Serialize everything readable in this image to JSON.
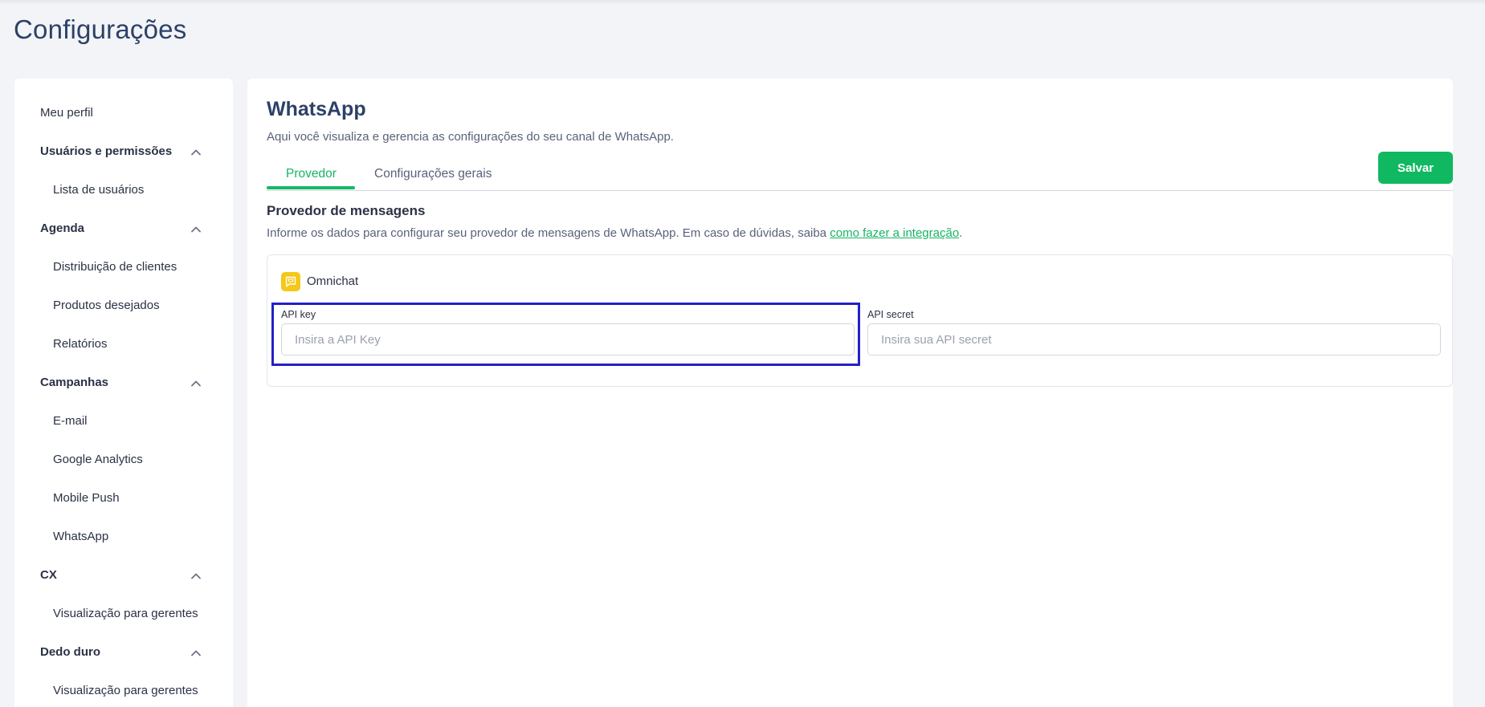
{
  "page": {
    "title": "Configurações"
  },
  "sidebar": {
    "items": [
      {
        "label": "Meu perfil",
        "type": "item"
      },
      {
        "label": "Usuários e permissões",
        "type": "section"
      },
      {
        "label": "Lista de usuários",
        "type": "sub"
      },
      {
        "label": "Agenda",
        "type": "section"
      },
      {
        "label": "Distribuição de clientes",
        "type": "sub"
      },
      {
        "label": "Produtos desejados",
        "type": "sub"
      },
      {
        "label": "Relatórios",
        "type": "sub"
      },
      {
        "label": "Campanhas",
        "type": "section"
      },
      {
        "label": "E-mail",
        "type": "sub"
      },
      {
        "label": "Google Analytics",
        "type": "sub"
      },
      {
        "label": "Mobile Push",
        "type": "sub"
      },
      {
        "label": "WhatsApp",
        "type": "sub"
      },
      {
        "label": "CX",
        "type": "section"
      },
      {
        "label": "Visualização para gerentes",
        "type": "sub"
      },
      {
        "label": "Dedo duro",
        "type": "section"
      },
      {
        "label": "Visualização para gerentes",
        "type": "sub"
      }
    ]
  },
  "main": {
    "title": "WhatsApp",
    "subtitle": "Aqui você visualiza e gerencia as configurações do seu canal de WhatsApp.",
    "tabs": [
      {
        "label": "Provedor",
        "active": true
      },
      {
        "label": "Configurações gerais",
        "active": false
      }
    ],
    "save_label": "Salvar",
    "provider": {
      "title": "Provedor de mensagens",
      "desc_prefix": "Informe os dados para configurar seu provedor de mensagens de WhatsApp. Em caso de dúvidas, saiba ",
      "desc_link": "como fazer a integração",
      "desc_suffix": ".",
      "card": {
        "name": "Omnichat",
        "icon": "omnichat-icon",
        "api_key": {
          "label": "API key",
          "placeholder": "Insira a API Key",
          "value": ""
        },
        "api_secret": {
          "label": "API secret",
          "placeholder": "Insira sua API secret",
          "value": ""
        }
      }
    }
  },
  "colors": {
    "accent": "#10b861",
    "title": "#2d4168",
    "highlight": "#2320c8",
    "omnichat": "#f5c818"
  }
}
